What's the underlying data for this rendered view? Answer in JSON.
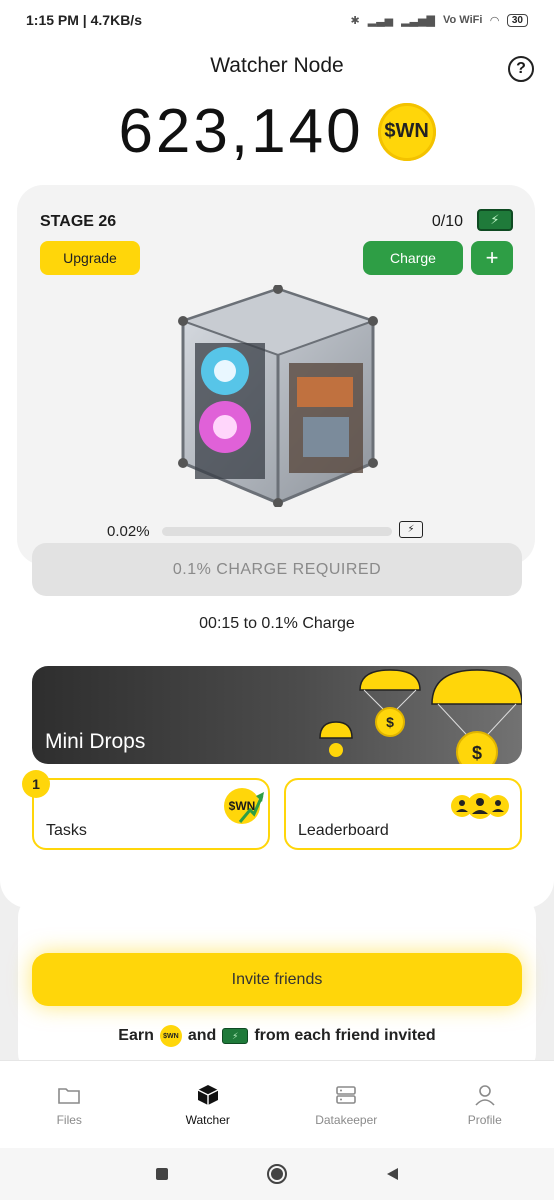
{
  "status_bar": {
    "time": "1:15 PM",
    "speed": "4.7KB/s",
    "vowifi": "Vo WiFi",
    "battery": "30"
  },
  "header": {
    "title": "Watcher Node",
    "help_icon": "?"
  },
  "balance": {
    "value": "623,140",
    "currency_logo": "$WN"
  },
  "node": {
    "stage": "STAGE 26",
    "charge_count": "0/10",
    "upgrade_label": "Upgrade",
    "charge_label": "Charge",
    "plus_label": "+",
    "progress_percent": 0.02,
    "progress_text": "0.02%",
    "image_icon": "computer-cube"
  },
  "required": {
    "label": "0.1% CHARGE REQUIRED"
  },
  "timer": {
    "text": "00:15 to 0.1% Charge"
  },
  "mini_drops": {
    "label": "Mini Drops"
  },
  "tasks": {
    "label": "Tasks",
    "badge": "1",
    "coin": "$WN"
  },
  "leaderboard": {
    "label": "Leaderboard"
  },
  "invite": {
    "button_label": "Invite friends",
    "earn_prefix": "Earn",
    "earn_and": "and",
    "earn_suffix": "from each friend invited",
    "coin": "$WN"
  },
  "bottom_nav": {
    "items": [
      {
        "label": "Files",
        "icon": "folder-icon"
      },
      {
        "label": "Watcher",
        "icon": "cube-icon"
      },
      {
        "label": "Datakeeper",
        "icon": "server-icon"
      },
      {
        "label": "Profile",
        "icon": "user-icon"
      }
    ],
    "active": "Watcher"
  },
  "colors": {
    "accent_yellow": "#ffd60a",
    "accent_green": "#2e9e45",
    "disabled_gray": "#e2e2e2"
  }
}
